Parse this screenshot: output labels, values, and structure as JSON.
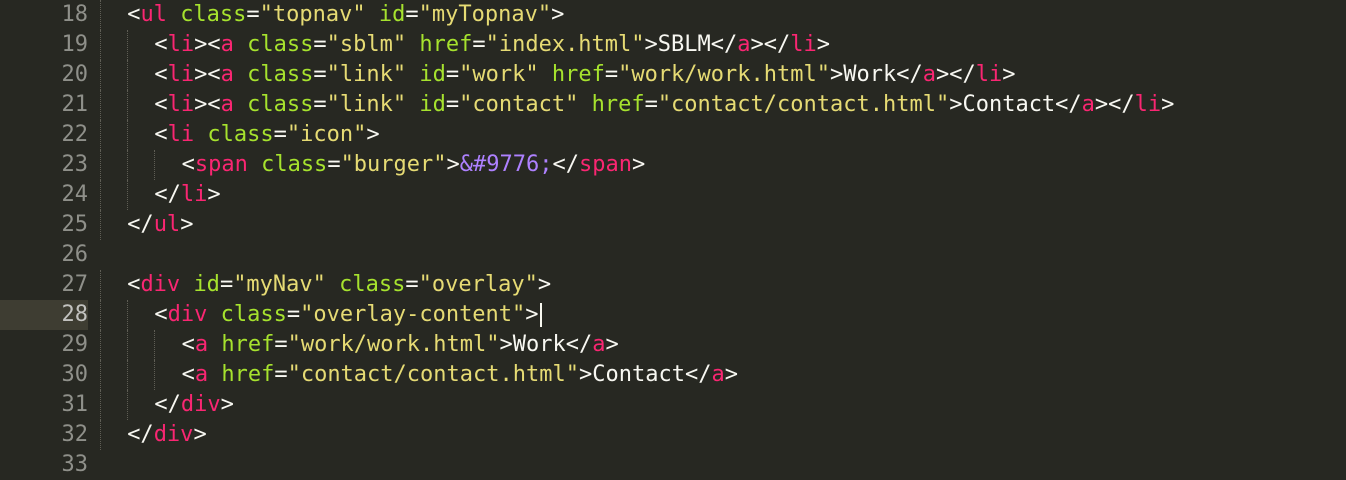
{
  "editor": {
    "theme_colors": {
      "background": "#272822",
      "tag": "#F92672",
      "attribute": "#A6E22E",
      "string": "#E6DB74",
      "entity": "#AE81FF",
      "text": "#F8F8F2",
      "gutter_text": "#8F908A",
      "active_line": "#3E3D32"
    },
    "active_line": "28",
    "lines": [
      {
        "number": "18",
        "indent": 1,
        "tokens": [
          [
            "pun",
            "<"
          ],
          [
            "tag",
            "ul"
          ],
          [
            "pun",
            " "
          ],
          [
            "attr",
            "class"
          ],
          [
            "pun",
            "="
          ],
          [
            "str",
            "\"topnav\""
          ],
          [
            "pun",
            " "
          ],
          [
            "attr",
            "id"
          ],
          [
            "pun",
            "="
          ],
          [
            "str",
            "\"myTopnav\""
          ],
          [
            "pun",
            ">"
          ]
        ]
      },
      {
        "number": "19",
        "indent": 2,
        "tokens": [
          [
            "pun",
            "<"
          ],
          [
            "tag",
            "li"
          ],
          [
            "pun",
            "><"
          ],
          [
            "tag",
            "a"
          ],
          [
            "pun",
            " "
          ],
          [
            "attr",
            "class"
          ],
          [
            "pun",
            "="
          ],
          [
            "str",
            "\"sblm\""
          ],
          [
            "pun",
            " "
          ],
          [
            "attr",
            "href"
          ],
          [
            "pun",
            "="
          ],
          [
            "str",
            "\"index.html\""
          ],
          [
            "pun",
            ">SBLM</"
          ],
          [
            "tag",
            "a"
          ],
          [
            "pun",
            "></"
          ],
          [
            "tag",
            "li"
          ],
          [
            "pun",
            ">"
          ]
        ]
      },
      {
        "number": "20",
        "indent": 2,
        "tokens": [
          [
            "pun",
            "<"
          ],
          [
            "tag",
            "li"
          ],
          [
            "pun",
            "><"
          ],
          [
            "tag",
            "a"
          ],
          [
            "pun",
            " "
          ],
          [
            "attr",
            "class"
          ],
          [
            "pun",
            "="
          ],
          [
            "str",
            "\"link\""
          ],
          [
            "pun",
            " "
          ],
          [
            "attr",
            "id"
          ],
          [
            "pun",
            "="
          ],
          [
            "str",
            "\"work\""
          ],
          [
            "pun",
            " "
          ],
          [
            "attr",
            "href"
          ],
          [
            "pun",
            "="
          ],
          [
            "str",
            "\"work/work.html\""
          ],
          [
            "pun",
            ">Work</"
          ],
          [
            "tag",
            "a"
          ],
          [
            "pun",
            "></"
          ],
          [
            "tag",
            "li"
          ],
          [
            "pun",
            ">"
          ]
        ]
      },
      {
        "number": "21",
        "indent": 2,
        "tokens": [
          [
            "pun",
            "<"
          ],
          [
            "tag",
            "li"
          ],
          [
            "pun",
            "><"
          ],
          [
            "tag",
            "a"
          ],
          [
            "pun",
            " "
          ],
          [
            "attr",
            "class"
          ],
          [
            "pun",
            "="
          ],
          [
            "str",
            "\"link\""
          ],
          [
            "pun",
            " "
          ],
          [
            "attr",
            "id"
          ],
          [
            "pun",
            "="
          ],
          [
            "str",
            "\"contact\""
          ],
          [
            "pun",
            " "
          ],
          [
            "attr",
            "href"
          ],
          [
            "pun",
            "="
          ],
          [
            "str",
            "\"contact/contact.html\""
          ],
          [
            "pun",
            ">Contact</"
          ],
          [
            "tag",
            "a"
          ],
          [
            "pun",
            "></"
          ],
          [
            "tag",
            "li"
          ],
          [
            "pun",
            ">"
          ]
        ]
      },
      {
        "number": "22",
        "indent": 2,
        "tokens": [
          [
            "pun",
            "<"
          ],
          [
            "tag",
            "li"
          ],
          [
            "pun",
            " "
          ],
          [
            "attr",
            "class"
          ],
          [
            "pun",
            "="
          ],
          [
            "str",
            "\"icon\""
          ],
          [
            "pun",
            ">"
          ]
        ]
      },
      {
        "number": "23",
        "indent": 3,
        "tokens": [
          [
            "pun",
            "<"
          ],
          [
            "tag",
            "span"
          ],
          [
            "pun",
            " "
          ],
          [
            "attr",
            "class"
          ],
          [
            "pun",
            "="
          ],
          [
            "str",
            "\"burger\""
          ],
          [
            "pun",
            ">"
          ],
          [
            "ent",
            "&#9776;"
          ],
          [
            "pun",
            "</"
          ],
          [
            "tag",
            "span"
          ],
          [
            "pun",
            ">"
          ]
        ]
      },
      {
        "number": "24",
        "indent": 2,
        "tokens": [
          [
            "pun",
            "</"
          ],
          [
            "tag",
            "li"
          ],
          [
            "pun",
            ">"
          ]
        ]
      },
      {
        "number": "25",
        "indent": 1,
        "tokens": [
          [
            "pun",
            "</"
          ],
          [
            "tag",
            "ul"
          ],
          [
            "pun",
            ">"
          ]
        ]
      },
      {
        "number": "26",
        "indent": 0,
        "tokens": []
      },
      {
        "number": "27",
        "indent": 1,
        "tokens": [
          [
            "pun",
            "<"
          ],
          [
            "tag",
            "div"
          ],
          [
            "pun",
            " "
          ],
          [
            "attr",
            "id"
          ],
          [
            "pun",
            "="
          ],
          [
            "str",
            "\"myNav\""
          ],
          [
            "pun",
            " "
          ],
          [
            "attr",
            "class"
          ],
          [
            "pun",
            "="
          ],
          [
            "str",
            "\"overlay\""
          ],
          [
            "pun",
            ">"
          ]
        ]
      },
      {
        "number": "28",
        "indent": 2,
        "caret": true,
        "tokens": [
          [
            "pun",
            "<"
          ],
          [
            "tag",
            "div"
          ],
          [
            "pun",
            " "
          ],
          [
            "attr",
            "class"
          ],
          [
            "pun",
            "="
          ],
          [
            "str",
            "\"overlay-content\""
          ],
          [
            "pun",
            ">"
          ]
        ]
      },
      {
        "number": "29",
        "indent": 3,
        "tokens": [
          [
            "pun",
            "<"
          ],
          [
            "tag",
            "a"
          ],
          [
            "pun",
            " "
          ],
          [
            "attr",
            "href"
          ],
          [
            "pun",
            "="
          ],
          [
            "str",
            "\"work/work.html\""
          ],
          [
            "pun",
            ">Work</"
          ],
          [
            "tag",
            "a"
          ],
          [
            "pun",
            ">"
          ]
        ]
      },
      {
        "number": "30",
        "indent": 3,
        "tokens": [
          [
            "pun",
            "<"
          ],
          [
            "tag",
            "a"
          ],
          [
            "pun",
            " "
          ],
          [
            "attr",
            "href"
          ],
          [
            "pun",
            "="
          ],
          [
            "str",
            "\"contact/contact.html\""
          ],
          [
            "pun",
            ">Contact</"
          ],
          [
            "tag",
            "a"
          ],
          [
            "pun",
            ">"
          ]
        ]
      },
      {
        "number": "31",
        "indent": 2,
        "tokens": [
          [
            "pun",
            "</"
          ],
          [
            "tag",
            "div"
          ],
          [
            "pun",
            ">"
          ]
        ]
      },
      {
        "number": "32",
        "indent": 1,
        "tokens": [
          [
            "pun",
            "</"
          ],
          [
            "tag",
            "div"
          ],
          [
            "pun",
            ">"
          ]
        ]
      },
      {
        "number": "33",
        "indent": 0,
        "tokens": []
      }
    ]
  }
}
